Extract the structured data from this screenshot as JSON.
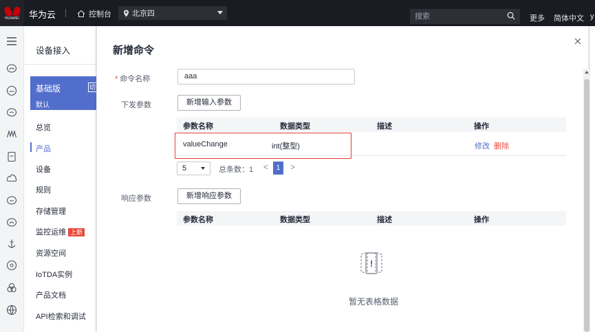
{
  "topbar": {
    "logo_text": "HUAWEI",
    "brand": "华为云",
    "console_label": "控制台",
    "region": "北京四",
    "search_placeholder": "搜索",
    "more_label": "更多",
    "language_label": "简体中文",
    "user_initial": "y"
  },
  "sidebar": {
    "title": "设备接入",
    "edition": {
      "name": "基础版",
      "sub": "默认",
      "switch_label": "切"
    },
    "items": [
      {
        "label": "总览"
      },
      {
        "label": "产品"
      },
      {
        "label": "设备"
      },
      {
        "label": "规则"
      },
      {
        "label": "存储管理"
      },
      {
        "label": "监控运维",
        "badge": "上新"
      },
      {
        "label": "资源空间"
      },
      {
        "label": "IoTDA实例"
      },
      {
        "label": "产品文档"
      },
      {
        "label": "API检索和调试"
      }
    ],
    "active_item": "产品"
  },
  "rail_icons": [
    "menu-icon",
    "cloud-icon",
    "cloud-icon",
    "cloud-icon",
    "iot-icon",
    "device-icon",
    "cloud-icon",
    "cloud-icon",
    "cloud-icon",
    "anchor-icon",
    "cloud-icon",
    "link-icon",
    "globe-icon"
  ],
  "dialog": {
    "title": "新增命令",
    "command_name_label": "命令名称",
    "command_name_value": "aaa",
    "send_params_label": "下发参数",
    "add_input_param_button": "新增输入参数",
    "response_params_label": "响应参数",
    "add_response_param_button": "新增响应参数",
    "table_headers": [
      "参数名称",
      "数据类型",
      "描述",
      "操作"
    ],
    "input_params": [
      {
        "name": "valueChange",
        "type": "int(整型)",
        "description": "",
        "edit": "修改",
        "delete": "删除"
      }
    ],
    "pager": {
      "page_size": "5",
      "total": "总条数：1",
      "current_page": "1",
      "prev": "<",
      "next": ">"
    },
    "empty_text": "暂无表格数据",
    "empty_icon_mark": "!"
  },
  "colors": {
    "accent": "#526ecc",
    "danger": "#e64a3b",
    "topbar": "#191c22",
    "highlight": "#e23c39"
  }
}
